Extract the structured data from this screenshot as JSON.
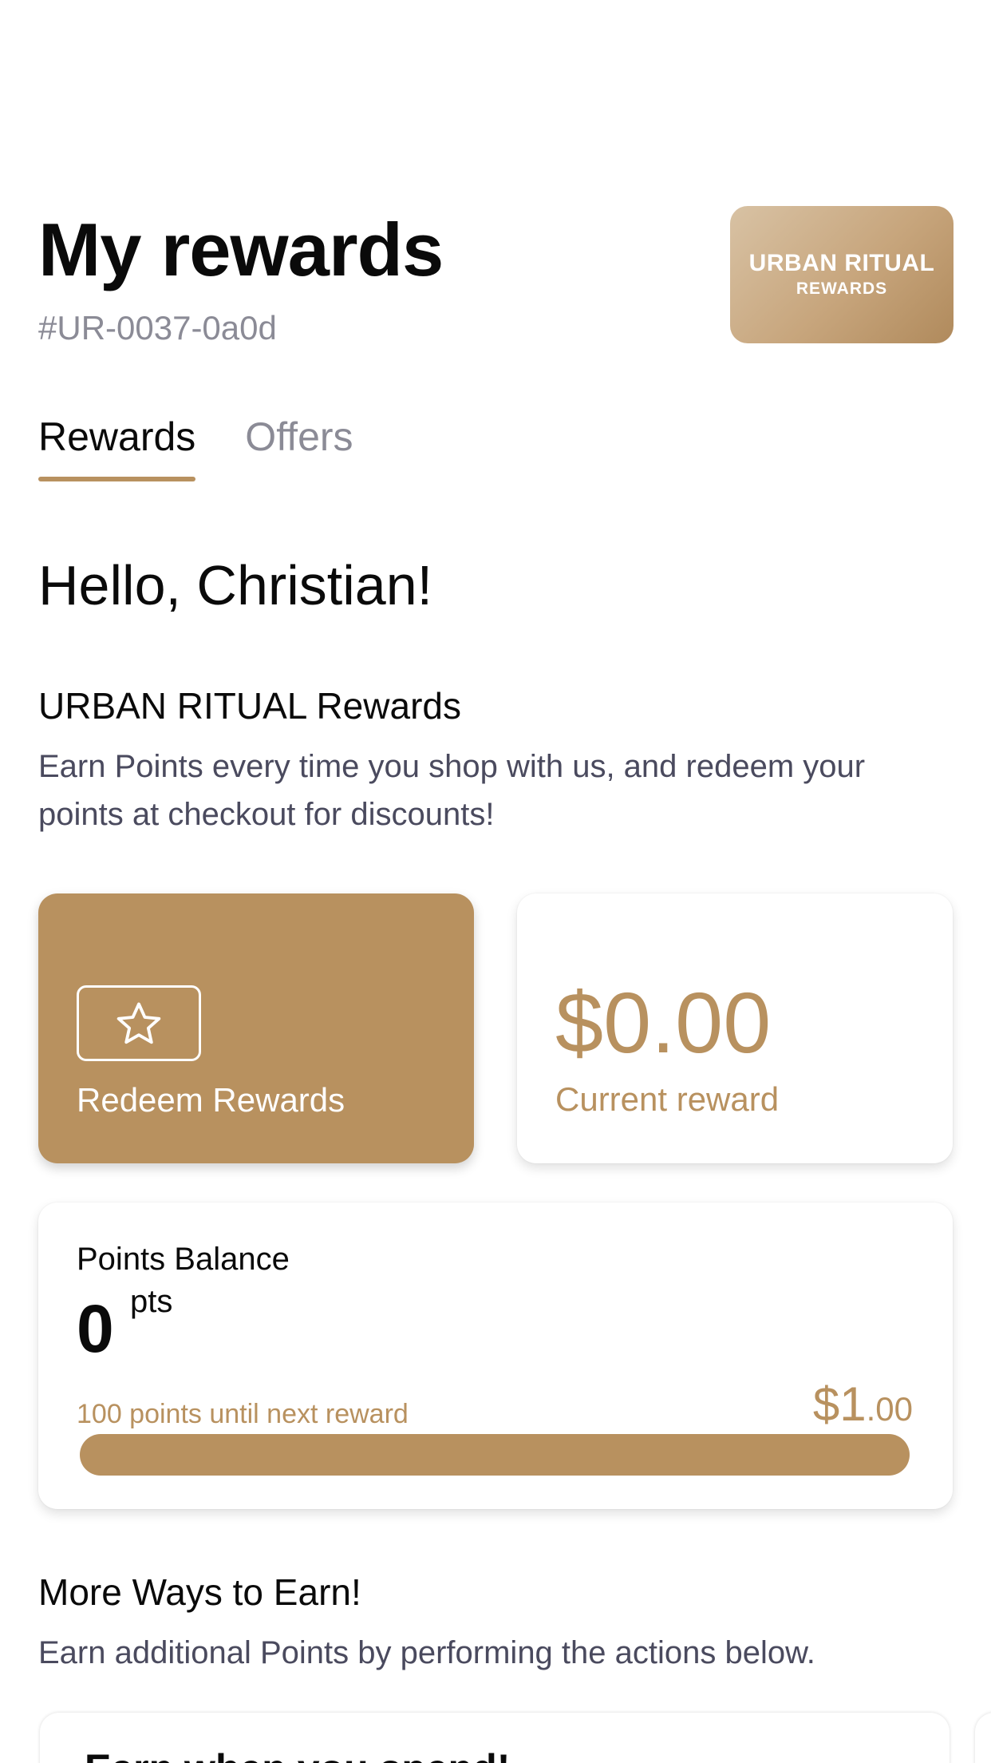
{
  "header": {
    "title": "My rewards",
    "member_id": "#UR-0037-0a0d",
    "brand_card": {
      "name": "URBAN RITUAL",
      "subtitle": "REWARDS"
    }
  },
  "tabs": [
    {
      "label": "Rewards",
      "active": true
    },
    {
      "label": "Offers",
      "active": false
    }
  ],
  "greeting": "Hello, Christian!",
  "program": {
    "title": "URBAN RITUAL Rewards",
    "description": "Earn Points every time you shop with us, and redeem your points at checkout for discounts!"
  },
  "redeem": {
    "label": "Redeem Rewards",
    "icon": "star-icon"
  },
  "current_reward": {
    "amount": "$0.00",
    "label": "Current reward"
  },
  "points_balance": {
    "title": "Points Balance",
    "value": "0",
    "unit": "pts",
    "until_next": "100 points until next reward",
    "next_reward_dollars": "$1",
    "next_reward_cents": ".00"
  },
  "more_ways": {
    "title": "More Ways to Earn!",
    "description": "Earn additional Points by performing the actions below.",
    "first_card_title": "Earn when you spend!"
  },
  "colors": {
    "accent": "#b8915f",
    "muted_text": "#8b8b96",
    "body_text": "#4a4a5e"
  }
}
